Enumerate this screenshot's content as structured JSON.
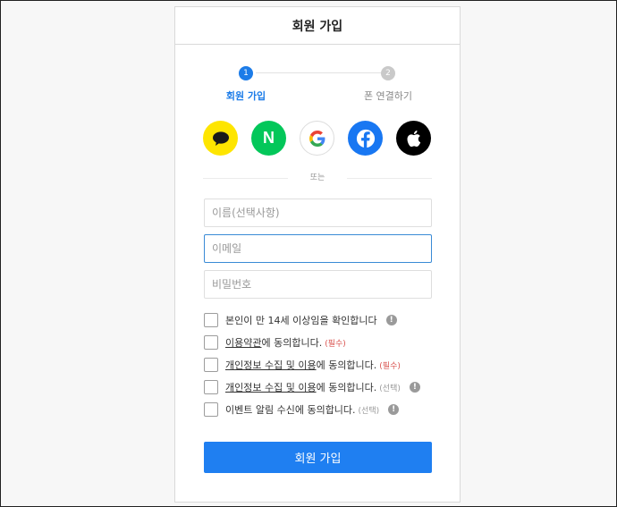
{
  "header": {
    "title": "회원 가입"
  },
  "steps": [
    {
      "num": "1",
      "label": "회원 가입",
      "state": "active"
    },
    {
      "num": "2",
      "label": "폰 연결하기",
      "state": "inactive"
    }
  ],
  "socials": [
    {
      "name": "kakao",
      "icon": "speech-bubble-icon",
      "color": "#fee500"
    },
    {
      "name": "naver",
      "icon": "n-letter-icon",
      "color": "#03c75a",
      "glyph": "N"
    },
    {
      "name": "google",
      "icon": "google-g-icon",
      "color": "#ffffff"
    },
    {
      "name": "facebook",
      "icon": "facebook-f-icon",
      "color": "#1877f2"
    },
    {
      "name": "apple",
      "icon": "apple-logo-icon",
      "color": "#000000"
    }
  ],
  "divider": {
    "text": "또는"
  },
  "form": {
    "name_placeholder": "이름(선택사항)",
    "email_placeholder": "이메일",
    "password_placeholder": "비밀번호"
  },
  "agreements": [
    {
      "text": "본인이 만 14세 이상임을 확인합니다",
      "tag": "",
      "info": true
    },
    {
      "link": "이용약관",
      "text": "에 동의합니다.",
      "tag": "(필수)",
      "info": false
    },
    {
      "link": "개인정보 수집 및 이용",
      "text": "에 동의합니다.",
      "tag": "(필수)",
      "info": false
    },
    {
      "link": "개인정보 수집 및 이용",
      "text": "에 동의합니다.",
      "tag": "(선택)",
      "info": true
    },
    {
      "text": "이벤트 알림 수신에 동의합니다.",
      "tag": "(선택)",
      "info": true
    }
  ],
  "info_glyph": "!",
  "submit": {
    "label": "회원 가입"
  },
  "colors": {
    "primary": "#1f7ff1",
    "required": "#d9534f",
    "step_inactive": "#c9c9c9"
  }
}
